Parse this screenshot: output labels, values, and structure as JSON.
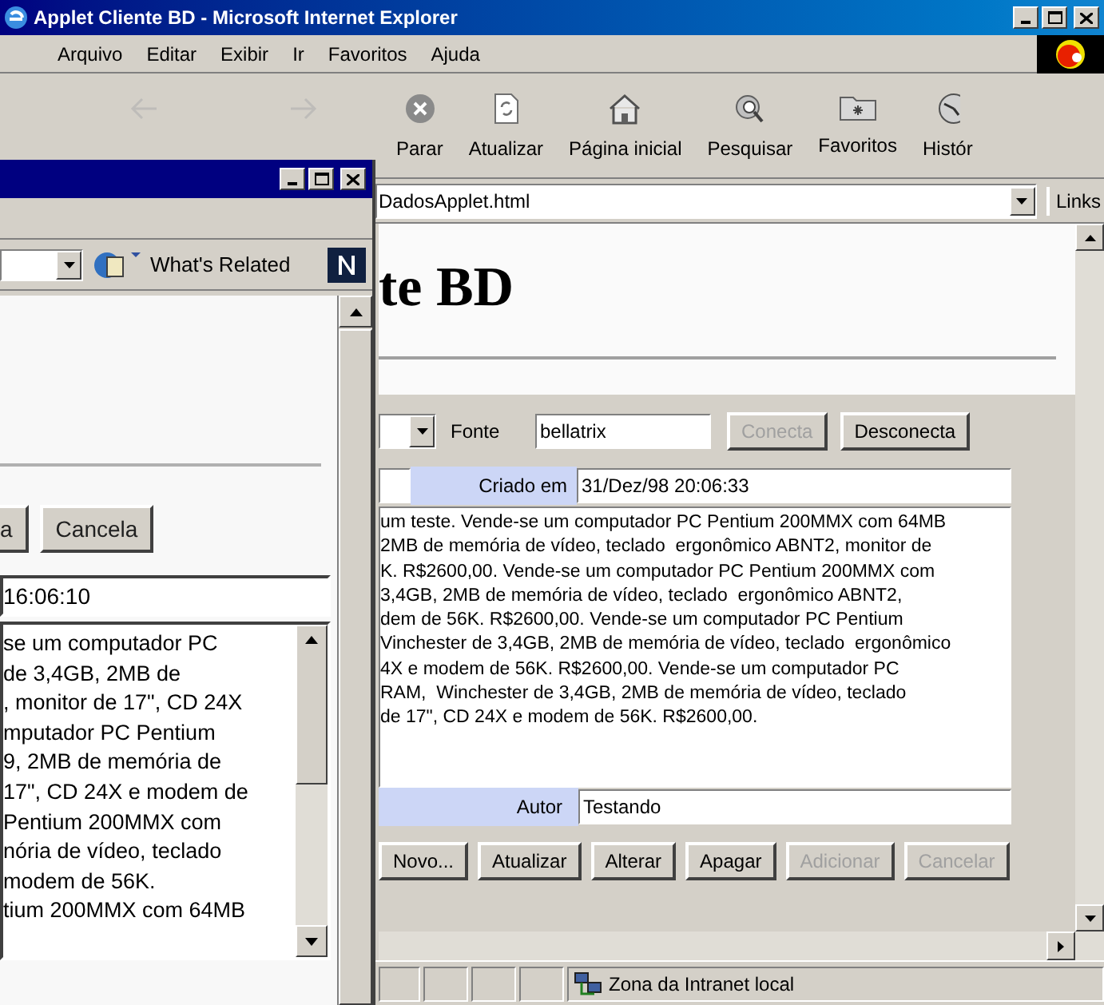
{
  "ie_window": {
    "title": "Applet Cliente BD - Microsoft Internet Explorer",
    "menu": [
      "Arquivo",
      "Editar",
      "Exibir",
      "Ir",
      "Favoritos",
      "Ajuda"
    ],
    "toolbar": [
      {
        "kind": "back",
        "disabled": true
      },
      {
        "kind": "forward",
        "disabled": true
      },
      {
        "kind": "stop",
        "label": "Parar",
        "disabled": false
      },
      {
        "kind": "refresh",
        "label": "Atualizar",
        "disabled": false
      },
      {
        "kind": "home",
        "label": "Página inicial",
        "disabled": false
      },
      {
        "kind": "search",
        "label": "Pesquisar",
        "disabled": false
      },
      {
        "kind": "favorites",
        "label": "Favoritos",
        "disabled": false
      },
      {
        "kind": "history",
        "label": "Histór",
        "disabled": false
      }
    ],
    "address": "DadosApplet.html",
    "links": "Links",
    "page": {
      "heading": "te BD",
      "fonte_label": "Fonte",
      "fonte_value": "bellatrix",
      "connect_buttons": [
        {
          "label": "Conecta",
          "disabled": true
        },
        {
          "label": "Desconecta",
          "disabled": false
        }
      ],
      "created_label": "Criado em",
      "created_value": "31/Dez/98 20:06:33",
      "text_lines": [
        "um teste. Vende-se um computador PC Pentium 200MMX com 64MB",
        "2MB de memória de vídeo, teclado  ergonômico ABNT2, monitor de",
        "K. R$2600,00. Vende-se um computador PC Pentium 200MMX com",
        "3,4GB, 2MB de memória de vídeo, teclado  ergonômico ABNT2,",
        "dem de 56K. R$2600,00. Vende-se um computador PC Pentium",
        "Vinchester de 3,4GB, 2MB de memória de vídeo, teclado  ergonômico",
        "4X e modem de 56K. R$2600,00. Vende-se um computador PC",
        "RAM,  Winchester de 3,4GB, 2MB de memória de vídeo, teclado",
        "de 17\", CD 24X e modem de 56K. R$2600,00."
      ],
      "author_label": "Autor",
      "author_value": "Testando",
      "action_buttons": [
        {
          "label": "Novo...",
          "disabled": false
        },
        {
          "label": "Atualizar",
          "disabled": false
        },
        {
          "label": "Alterar",
          "disabled": false
        },
        {
          "label": "Apagar",
          "disabled": false
        },
        {
          "label": "Adicionar",
          "disabled": true
        },
        {
          "label": "Cancelar",
          "disabled": true
        }
      ]
    },
    "status": "Zona da Intranet local"
  },
  "netscape_window": {
    "whats_related": "What's Related",
    "buttons": [
      {
        "label": "a"
      },
      {
        "label": "Cancela"
      }
    ],
    "time_value": "16:06:10",
    "text_lines": [
      "se um computador PC",
      "de 3,4GB, 2MB de",
      ", monitor de 17\", CD 24X",
      "mputador PC Pentium",
      "9, 2MB de memória de",
      "17\", CD 24X e modem de",
      "Pentium 200MMX com",
      "nória de vídeo, teclado",
      "modem de 56K.",
      "tium 200MMX com 64MB"
    ]
  }
}
